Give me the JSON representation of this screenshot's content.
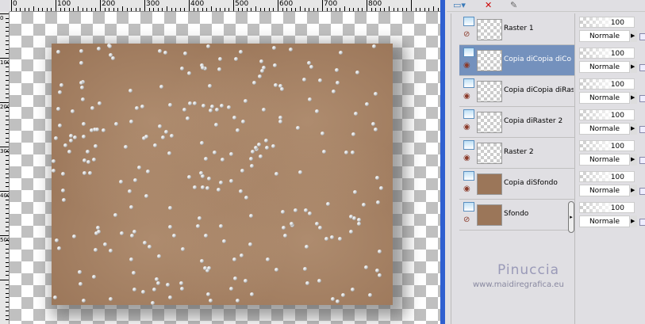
{
  "ruler": {
    "h_labels": [
      "0",
      "100",
      "200",
      "300",
      "400",
      "500",
      "600",
      "700",
      "800"
    ],
    "v_labels": [
      "0",
      "100",
      "200",
      "300",
      "400",
      "500"
    ]
  },
  "toolbar": {
    "icons": [
      "new-layer-icon",
      "delete-layer-icon",
      "edit-mask-icon"
    ]
  },
  "layers": [
    {
      "name": "Raster 1",
      "visible": false,
      "selected": false
    },
    {
      "name": "Copia diCopia diCo",
      "visible": true,
      "selected": true
    },
    {
      "name": "Copia diCopia diRas",
      "visible": true,
      "selected": false
    },
    {
      "name": "Copia diRaster 2",
      "visible": true,
      "selected": false
    },
    {
      "name": "Raster 2",
      "visible": true,
      "selected": false
    },
    {
      "name": "Copia diSfondo",
      "visible": true,
      "selected": false
    },
    {
      "name": "Sfondo",
      "visible": false,
      "selected": false
    }
  ],
  "props": [
    {
      "opacity": "100",
      "mode": "Normale"
    },
    {
      "opacity": "100",
      "mode": "Normale"
    },
    {
      "opacity": "100",
      "mode": "Normale"
    },
    {
      "opacity": "100",
      "mode": "Normale"
    },
    {
      "opacity": "100",
      "mode": "Normale"
    },
    {
      "opacity": "100",
      "mode": "Normale"
    },
    {
      "opacity": "100",
      "mode": "Normale"
    }
  ],
  "watermark": {
    "name": "Pinuccia",
    "url": "www.maidiregrafica.eu"
  },
  "colors": {
    "selection": "#7491bd",
    "image": "#9b7659"
  }
}
